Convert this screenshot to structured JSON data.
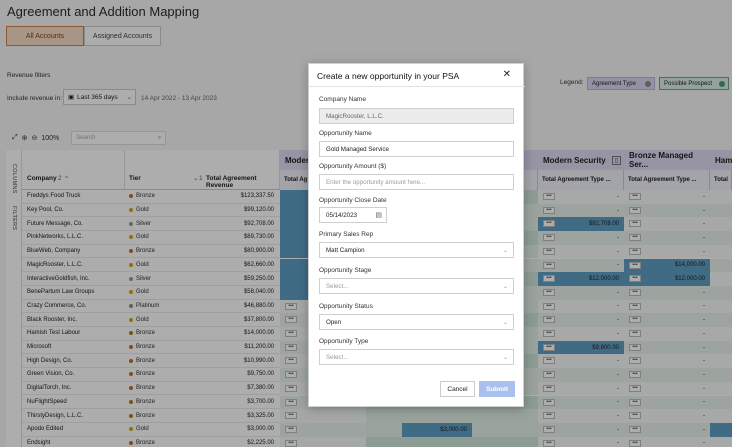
{
  "page": {
    "title": "Agreement and Addition Mapping",
    "tabs": [
      "All Accounts",
      "Assigned Accounts"
    ],
    "revenue_filters_label": "Revenue filters",
    "include_label": "Include revenue in:",
    "period": "Last 365 days",
    "date_range": "14 Apr 2022 - 13 Apr 2023",
    "legend_label": "Legend:",
    "legend_items": [
      "Agreement Type",
      "Possible Prospect"
    ],
    "zoom": "100%",
    "search_placeholder": "Search"
  },
  "sidebar": {
    "columns": "COLUMNS",
    "filters": "FILTERS"
  },
  "grid": {
    "col_company": "Company",
    "col_tier": "Tier",
    "col_total": "Total Agreement Revenue",
    "sort_badge_company": "2",
    "sort_badge_tier": "1",
    "groups": [
      "Modern",
      "Modern Security",
      "Bronze Managed Ser...",
      "Ham"
    ],
    "subheaders": [
      "Total Ag",
      "Total Agreement Type ...",
      "Total Agreement Type ...",
      "Total"
    ],
    "rows": [
      {
        "company": "Freddys Food Truck",
        "tier": "Bronze",
        "total": "$123,337.50",
        "ms": "-",
        "bm": "-"
      },
      {
        "company": "Key Pool, Co.",
        "tier": "Gold",
        "total": "$99,120.00",
        "ms": "-",
        "bm": "-"
      },
      {
        "company": "Future Message, Co.",
        "tier": "Silver",
        "total": "$92,708.00",
        "ms": "$92,708.00",
        "bm": "-"
      },
      {
        "company": "PinkNetworks, L.L.C.",
        "tier": "Gold",
        "total": "$89,730.00",
        "ms": "-",
        "bm": "-"
      },
      {
        "company": "BlueWeb, Company",
        "tier": "Bronze",
        "total": "$80,900.00",
        "ms": "-",
        "bm": "-"
      },
      {
        "company": "MagicRooster, L.L.C.",
        "tier": "Gold",
        "total": "$62,660.00",
        "ms": "-",
        "bm": "$14,000.00"
      },
      {
        "company": "InteractiveGoldfish, Inc.",
        "tier": "Silver",
        "total": "$59,250.00",
        "ms": "$12,000.00",
        "bm": "$12,000.00"
      },
      {
        "company": "BenePartum Law Groups",
        "tier": "Gold",
        "total": "$58,040.00",
        "ms": "-",
        "bm": "-"
      },
      {
        "company": "Crazy Commerce, Co.",
        "tier": "Platinum",
        "total": "$46,880.00",
        "ms": "-",
        "bm": "-"
      },
      {
        "company": "Black Rooster, Inc.",
        "tier": "Gold",
        "total": "$37,800.00",
        "ms": "-",
        "bm": "-"
      },
      {
        "company": "Hamish Test Labour",
        "tier": "Bronze",
        "total": "$14,000.00",
        "ms": "-",
        "bm": "-"
      },
      {
        "company": "Microsoft",
        "tier": "Bronze",
        "total": "$11,200.00",
        "ms": "$9,600.00",
        "bm": "-"
      },
      {
        "company": "High Design, Co.",
        "tier": "Bronze",
        "total": "$10,990.00",
        "ms": "-",
        "bm": "-"
      },
      {
        "company": "Green Vision, Co.",
        "tier": "Bronze",
        "total": "$9,750.00",
        "ms": "-",
        "bm": "-"
      },
      {
        "company": "DigitalTorch, Inc.",
        "tier": "Bronze",
        "total": "$7,380.00",
        "ms": "-",
        "bm": "-"
      },
      {
        "company": "NuFlightSpeed",
        "tier": "Bronze",
        "total": "$3,700.00",
        "ms": "-",
        "bm": "-"
      },
      {
        "company": "ThirstyDesign, L.L.C.",
        "tier": "Bronze",
        "total": "$3,325.00",
        "ms": "-",
        "bm": "-"
      },
      {
        "company": "Apodo Edited",
        "tier": "Gold",
        "total": "$3,000.00",
        "ms": "-",
        "bm": "-"
      },
      {
        "company": "Endsight",
        "tier": "Bronze",
        "total": "$2,225.00",
        "ms": "-",
        "bm": "-"
      }
    ],
    "hidden_cell_value": "$3,000.00"
  },
  "tier_colors": {
    "Bronze": "#b5761d",
    "Gold": "#d2a800",
    "Silver": "#9a9a9a",
    "Platinum": "#8a8a8a"
  },
  "modal": {
    "title": "Create a new opportunity in your PSA",
    "company_label": "Company Name",
    "company_value": "MagicRooster, L.L.C.",
    "opp_name_label": "Opportunity Name",
    "opp_name_value": "Gold Managed Service",
    "amount_label": "Opportunity Amount ($)",
    "amount_placeholder": "Enter the opportunity amount here...",
    "close_label": "Opportunity Close Date",
    "close_value": "05/14/2023",
    "rep_label": "Primary Sales Rep",
    "rep_value": "Matt Campion",
    "stage_label": "Opportunity Stage",
    "stage_placeholder": "Select...",
    "status_label": "Opportunity Status",
    "status_value": "Open",
    "type_label": "Opportunity Type",
    "type_placeholder": "Select...",
    "cancel": "Cancel",
    "submit": "Submit"
  }
}
